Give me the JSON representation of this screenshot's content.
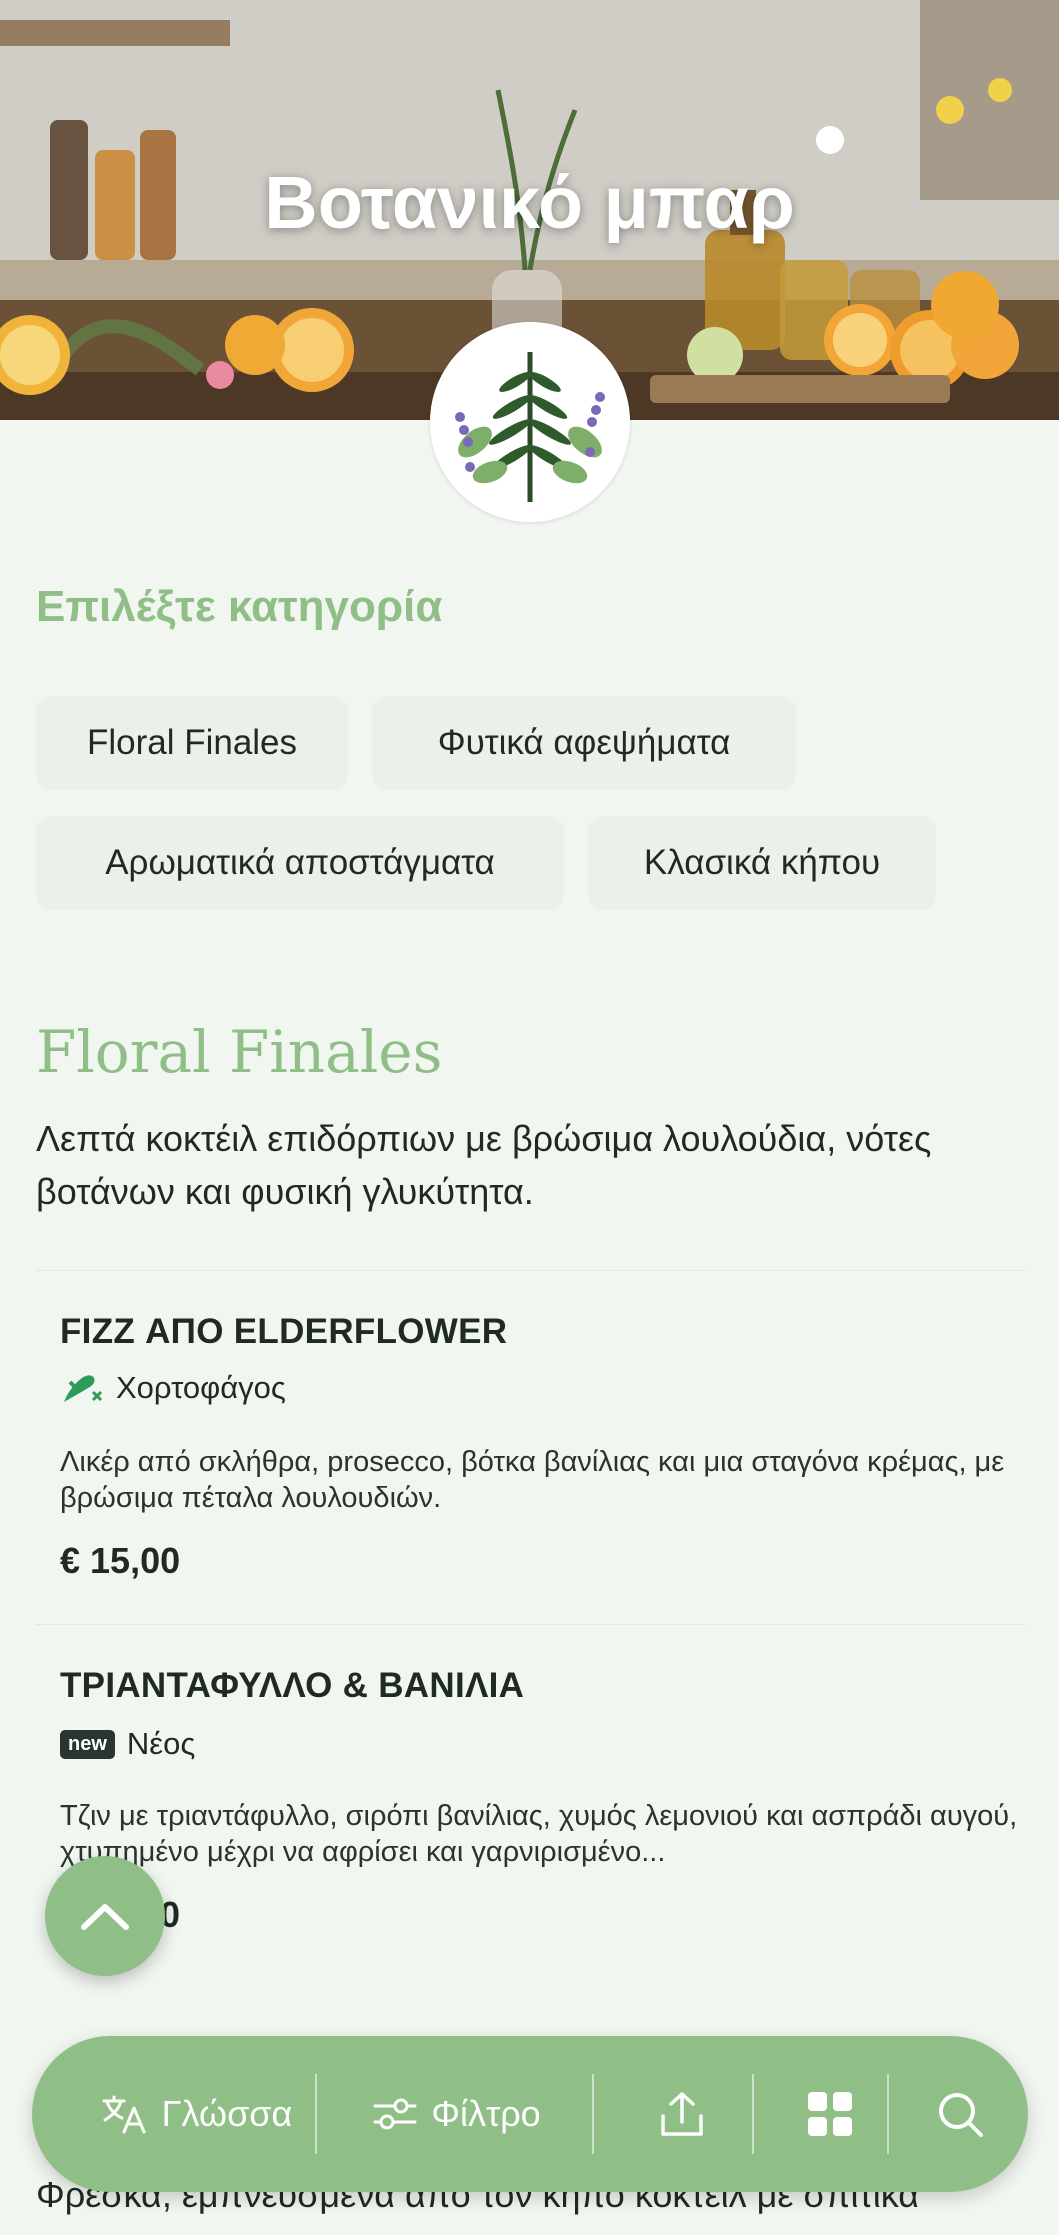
{
  "header": {
    "title": "Βοτανικό μπαρ"
  },
  "categories": {
    "heading": "Επιλέξτε κατηγορία",
    "items": [
      "Floral Finales",
      "Φυτικά αφεψήματα",
      "Αρωματικά αποστάγματα",
      "Κλασικά κήπου"
    ]
  },
  "section": {
    "title": "Floral Finales",
    "description": "Λεπτά κοκτέιλ επιδόρπιων με βρώσιμα λουλούδια, νότες βοτάνων και φυσική γλυκύτητα."
  },
  "menu_items": [
    {
      "name": "FIZZ ΑΠΟ ELDERFLOWER",
      "tag_icon": "vegetarian-icon",
      "tag": "Χορτοφάγος",
      "description": "Λικέρ από σκλήθρα, prosecco, βότκα βανίλιας και μια σταγόνα κρέμας, με βρώσιμα πέταλα λουλουδιών.",
      "price": "€ 15,00"
    },
    {
      "name": "ΤΡΙΑΝΤΑΦΥΛΛΟ & ΒΑΝΙΛΙΑ",
      "tag_badge": "new",
      "tag": "Νέος",
      "description": "Τζιν με τριαντάφυλλο, σιρόπι βανίλιας, χυμός λεμονιού και ασπράδι αυγού, χτυπημένο μέχρι να αφρίσει και γαρνιρισμένο...",
      "price": "0"
    }
  ],
  "next_section": {
    "description_partial": "Φρέσκα, εμπνευσμένα από τον κήπο κοκτέιλ με σπιτικά"
  },
  "bottom_bar": {
    "language_label": "Γλώσσα",
    "filter_label": "Φίλτρο",
    "share_icon": "share-icon",
    "grid_icon": "grid-icon",
    "search_icon": "search-icon"
  },
  "colors": {
    "accent": "#8fbf86",
    "background": "#f2f6f1",
    "chip": "#ebf1e9",
    "text": "#1f2a24"
  }
}
